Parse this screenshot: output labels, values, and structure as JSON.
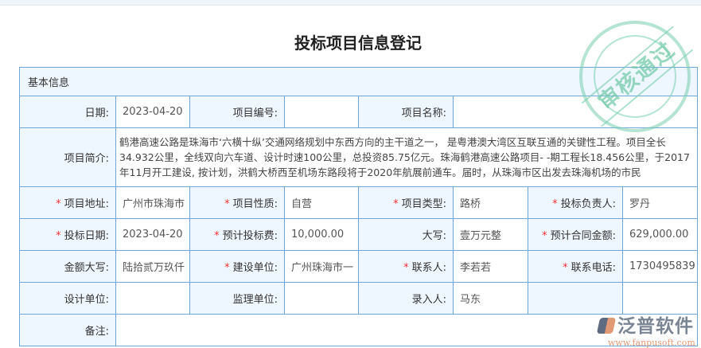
{
  "page": {
    "title": "投标项目信息登记",
    "section": "基本信息"
  },
  "stamp": {
    "text": "审核通过"
  },
  "logo": {
    "name": "泛普软件",
    "url": "www.fanpusoft.com"
  },
  "fields": {
    "date": {
      "label": "日期:",
      "value": "2023-04-20"
    },
    "project_no": {
      "label": "项目编号:",
      "value": ""
    },
    "project_name": {
      "label": "项目名称:",
      "value": ""
    },
    "intro": {
      "label": "项目简介:",
      "value": "鹤港高速公路是珠海市‘六横十纵’交通网络规划中东西方向的主干道之一， 是粤港澳大湾区互联互通的关键性工程。项目全长34.932公里，全线双向六车道、设计时速100公里，总投资85.75亿元。珠海鹤港高速公路项目- -期工程长18.456公里，于2017年11月开工建设, 按计划，洪鹤大桥西至机场东路段将于2020年航展前通车。届时，从珠海市区出发去珠海机场的市民"
    },
    "address": {
      "label": "项目地址:",
      "value": "广州市珠海市"
    },
    "nature": {
      "label": "项目性质:",
      "value": "自营"
    },
    "type": {
      "label": "项目类型:",
      "value": "路桥"
    },
    "manager": {
      "label": "投标负责人:",
      "value": "罗丹"
    },
    "bid_date": {
      "label": "投标日期:",
      "value": "2023-04-20"
    },
    "bid_fee": {
      "label": "预计投标费:",
      "value": "10,000.00"
    },
    "capital": {
      "label": "大写:",
      "value": "壹万元整"
    },
    "contract_amount": {
      "label": "预计合同金额:",
      "value": "629,000.00"
    },
    "amount_capital": {
      "label": "金额大写:",
      "value": "陆拾贰万玖仟"
    },
    "builder": {
      "label": "建设单位:",
      "value": "广州珠海市一"
    },
    "contact": {
      "label": "联系人:",
      "value": "李若若"
    },
    "phone": {
      "label": "联系电话:",
      "value": "1730495839"
    },
    "design_unit": {
      "label": "设计单位:",
      "value": ""
    },
    "supervisor": {
      "label": "监理单位:",
      "value": ""
    },
    "entered_by": {
      "label": "录入人:",
      "value": "马东"
    },
    "remark": {
      "label": "备注:",
      "value": ""
    }
  },
  "required_mark": "*"
}
